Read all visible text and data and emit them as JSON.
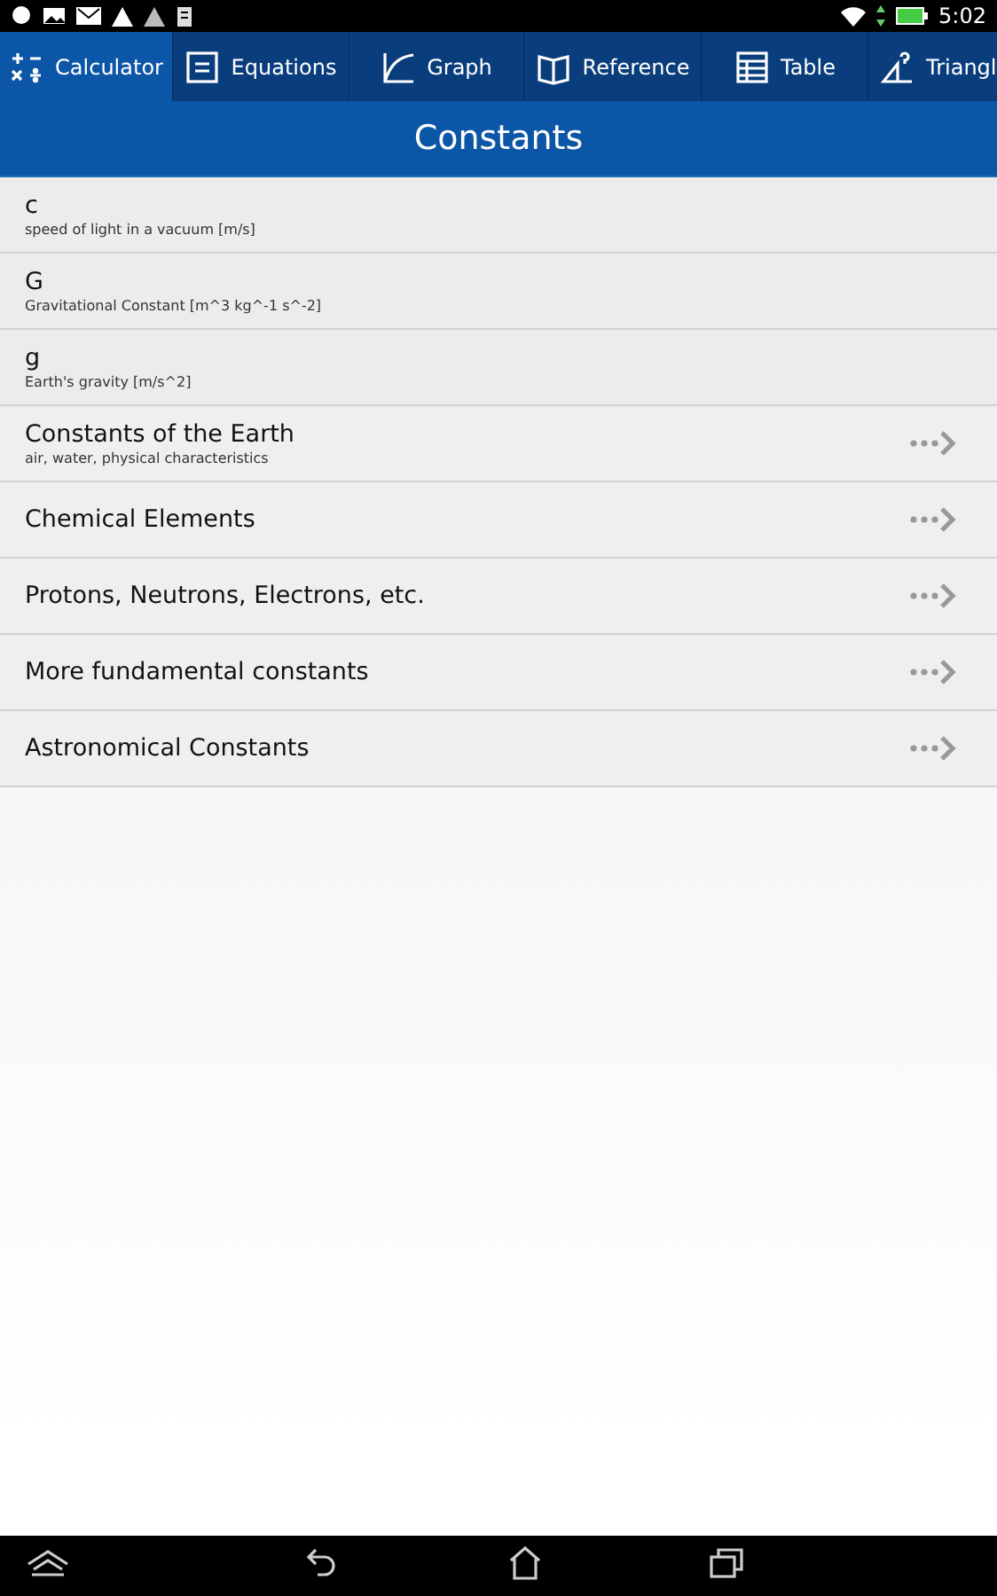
{
  "status_bar": {
    "time": "5:02"
  },
  "tabs": [
    {
      "label": "Calculator",
      "kind": "calc",
      "selected": true
    },
    {
      "label": "Equations",
      "kind": "eq",
      "selected": false
    },
    {
      "label": "Graph",
      "kind": "graph",
      "selected": false
    },
    {
      "label": "Reference",
      "kind": "book",
      "selected": false
    },
    {
      "label": "Table",
      "kind": "table",
      "selected": false
    },
    {
      "label": "Triangl",
      "kind": "tri",
      "selected": false
    }
  ],
  "header": {
    "title": "Constants"
  },
  "items": [
    {
      "kind": "constant",
      "title": "c",
      "subtitle": "speed of light in a vacuum [m/s]"
    },
    {
      "kind": "constant",
      "title": "G",
      "subtitle": "Gravitational Constant [m^3 kg^-1 s^-2]"
    },
    {
      "kind": "constant",
      "title": "g",
      "subtitle": "Earth's gravity [m/s^2]"
    },
    {
      "kind": "category",
      "title": "Constants of the Earth",
      "subtitle": "air, water, physical characteristics"
    },
    {
      "kind": "category",
      "title": "Chemical Elements"
    },
    {
      "kind": "category",
      "title": "Protons, Neutrons, Electrons, etc."
    },
    {
      "kind": "category",
      "title": "More fundamental constants"
    },
    {
      "kind": "category",
      "title": "Astronomical Constants"
    }
  ]
}
